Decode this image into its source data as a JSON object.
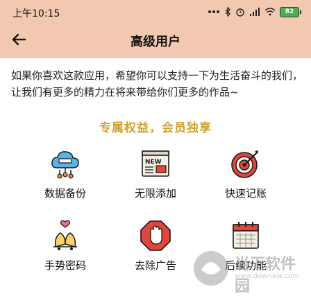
{
  "status_bar": {
    "time": "上午10:15",
    "battery": "82"
  },
  "nav": {
    "title": "高级用户"
  },
  "intro": "如果你喜欢这款应用，希望你可以支持一下为生活奋斗的我们，让我们有更多的精力在将来带给你们更多的作品~",
  "section_title": "专属权益，会员独享",
  "features": [
    {
      "label": "数据备份",
      "icon": "cloud-backup-icon"
    },
    {
      "label": "无限添加",
      "icon": "news-icon"
    },
    {
      "label": "快速记账",
      "icon": "target-icon"
    },
    {
      "label": "手势密码",
      "icon": "bells-icon"
    },
    {
      "label": "去除广告",
      "icon": "stop-hand-icon"
    },
    {
      "label": "后续功能",
      "icon": "calendar-icon"
    }
  ],
  "watermark": {
    "text": "当下软件园",
    "sub": "www.downxia.com"
  },
  "colors": {
    "header_bg": "#f2c9b0",
    "section_title": "#d4a22c"
  }
}
